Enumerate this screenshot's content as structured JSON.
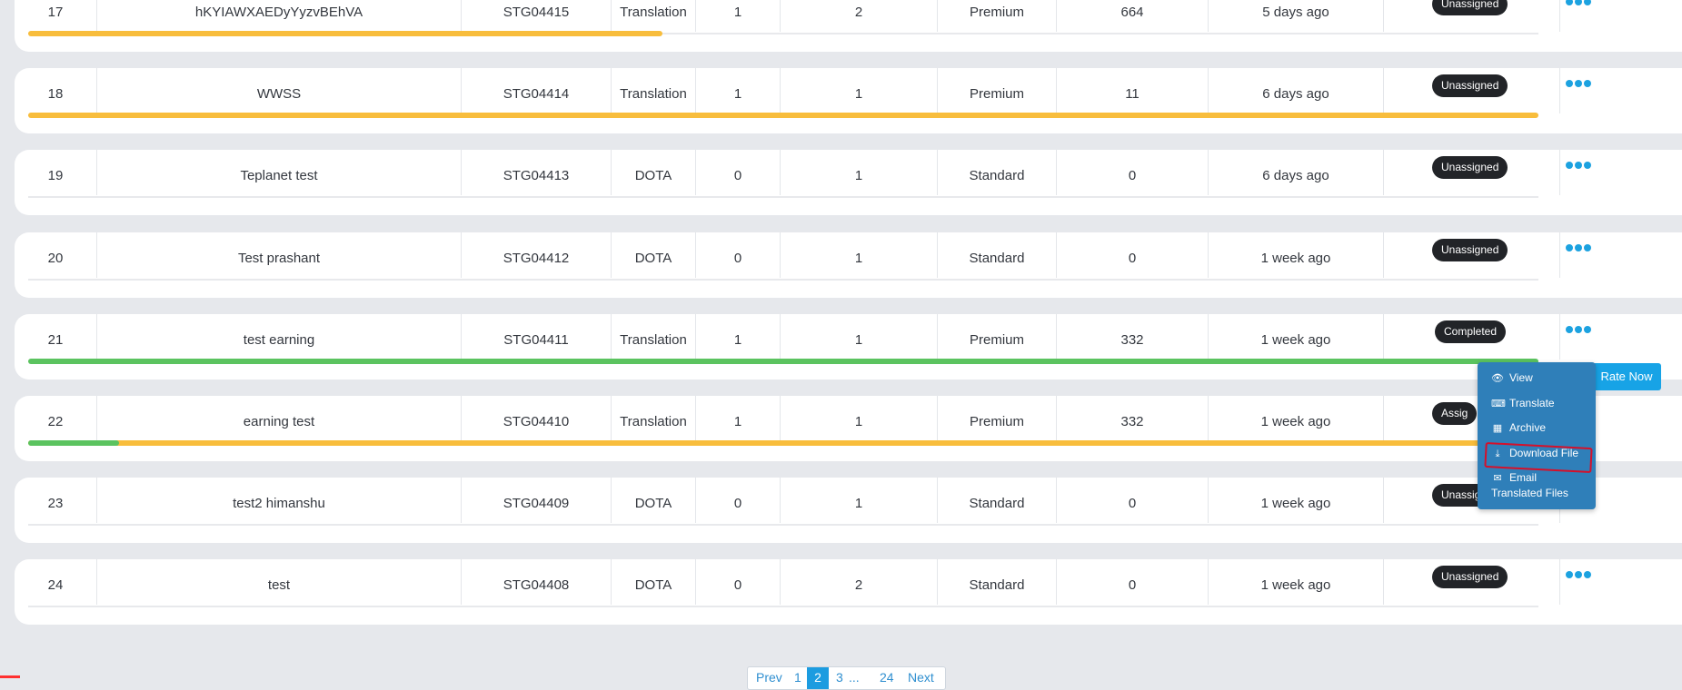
{
  "colors": {
    "progress_yellow": "#f8bd3c",
    "progress_green": "#5bc35f",
    "badge_dark": "#222428",
    "accent_blue": "#1ca2e0",
    "menu_blue": "#2f7fb9"
  },
  "rows": [
    {
      "num": "17",
      "name": "hKYIAWXAEDyYyzvBEhVA",
      "code": "STG04415",
      "type": "Translation",
      "col5": "1",
      "col6": "2",
      "plan": "Premium",
      "words": "664",
      "time": "5 days ago",
      "status": "Unassigned",
      "progress": {
        "yellow": 0.42,
        "green": 0
      }
    },
    {
      "num": "18",
      "name": "WWSS",
      "code": "STG04414",
      "type": "Translation",
      "col5": "1",
      "col6": "1",
      "plan": "Premium",
      "words": "11",
      "time": "6 days ago",
      "status": "Unassigned",
      "progress": {
        "yellow": 1.0,
        "green": 0
      }
    },
    {
      "num": "19",
      "name": "Teplanet test",
      "code": "STG04413",
      "type": "DOTA",
      "col5": "0",
      "col6": "1",
      "plan": "Standard",
      "words": "0",
      "time": "6 days ago",
      "status": "Unassigned",
      "progress": {
        "yellow": 0,
        "green": 0
      }
    },
    {
      "num": "20",
      "name": "Test prashant",
      "code": "STG04412",
      "type": "DOTA",
      "col5": "0",
      "col6": "1",
      "plan": "Standard",
      "words": "0",
      "time": "1 week ago",
      "status": "Unassigned",
      "progress": {
        "yellow": 0,
        "green": 0
      }
    },
    {
      "num": "21",
      "name": "test earning",
      "code": "STG04411",
      "type": "Translation",
      "col5": "1",
      "col6": "1",
      "plan": "Premium",
      "words": "332",
      "time": "1 week ago",
      "status": "Completed",
      "progress": {
        "yellow": 0,
        "green": 1.0
      }
    },
    {
      "num": "22",
      "name": "earning test",
      "code": "STG04410",
      "type": "Translation",
      "col5": "1",
      "col6": "1",
      "plan": "Premium",
      "words": "332",
      "time": "1 week ago",
      "status": "Assig",
      "progress": {
        "yellow": 1.0,
        "green": 0.06
      }
    },
    {
      "num": "23",
      "name": "test2 himanshu",
      "code": "STG04409",
      "type": "DOTA",
      "col5": "0",
      "col6": "1",
      "plan": "Standard",
      "words": "0",
      "time": "1 week ago",
      "status": "Unassigned",
      "progress": {
        "yellow": 0,
        "green": 0
      }
    },
    {
      "num": "24",
      "name": "test",
      "code": "STG04408",
      "type": "DOTA",
      "col5": "0",
      "col6": "2",
      "plan": "Standard",
      "words": "0",
      "time": "1 week ago",
      "status": "Unassigned",
      "progress": {
        "yellow": 0,
        "green": 0
      }
    }
  ],
  "menu": {
    "items": [
      {
        "label": "View",
        "icon": "eye-icon",
        "glyph": "👁"
      },
      {
        "label": "Translate",
        "icon": "translate-icon",
        "glyph": "⌨"
      },
      {
        "label": "Archive",
        "icon": "archive-icon",
        "glyph": "▦"
      },
      {
        "label": "Download File",
        "icon": "download-icon",
        "glyph": "⤓"
      },
      {
        "label": "Email",
        "icon": "email-icon",
        "glyph": "✉"
      }
    ],
    "email_line2": "Translated Files",
    "rate_now": "Rate Now"
  },
  "pagination": {
    "prev": "Prev",
    "pages": [
      "1",
      "2",
      "3",
      "...",
      "24"
    ],
    "current": "2",
    "next": "Next"
  }
}
